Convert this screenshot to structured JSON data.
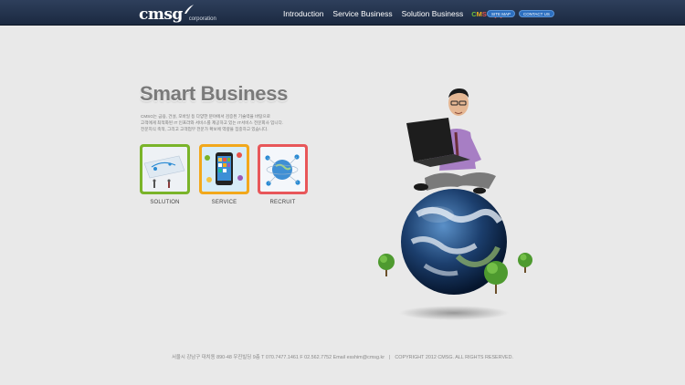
{
  "header": {
    "logo_text": "cmsg",
    "logo_sub": "corporation",
    "nav": [
      {
        "label": "Introduction"
      },
      {
        "label": "Service Business"
      },
      {
        "label": "Solution Business"
      }
    ],
    "cmsg_link": {
      "c": "C",
      "m": "M",
      "s": "S",
      "g": "G"
    },
    "buttons": {
      "sitemap": "SITE MAP",
      "contact": "CONTACT US"
    }
  },
  "main": {
    "title": "Smart Business",
    "description": [
      "CMSG는 금융, 건설, 모바일 등 다양한 분야에서 검증된 기술력을 바탕으로",
      "고객에게 최적화된 IT 인프라와 서비스를 제공하고 있는 IT서비스 전문회사 입니다.",
      "전문지식 축적, 그리고 고객업무 전문가 확보에 역량을 집중하고 있습니다."
    ],
    "tiles": [
      {
        "label": "SOLUTION",
        "color": "#7ab42a"
      },
      {
        "label": "SERVICE",
        "color": "#f2a81c"
      },
      {
        "label": "RECRUIT",
        "color": "#e8575a"
      }
    ]
  },
  "footer": {
    "address": "서울시 강남구 대치동 890-48 우진빌딩 9층 T 070.7477.1461 F 02.562.7752 Email esshim@cmsg.kr",
    "separator": "|",
    "copyright": "COPYRIGHT 2012 CMSG.  ALL RIGHTS RESERVED."
  },
  "colors": {
    "header_bg": "#1f2d46",
    "page_bg": "#e9e9e9",
    "button_blue": "#2c6fc0"
  }
}
